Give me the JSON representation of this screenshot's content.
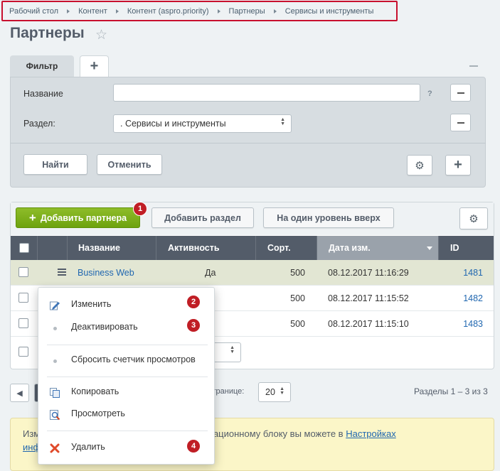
{
  "breadcrumb": [
    "Рабочий стол",
    "Контент",
    "Контент (aspro.priority)",
    "Партнеры",
    "Сервисы и инструменты"
  ],
  "page": {
    "title": "Партнеры"
  },
  "filter": {
    "tab_label": "Фильтр",
    "name_label": "Название",
    "name_value": "",
    "help": "?",
    "section_label": "Раздел:",
    "section_value": ". Сервисы и инструменты",
    "find_button": "Найти",
    "cancel_button": "Отменить"
  },
  "toolbar": {
    "add_partner": "Добавить партнера",
    "add_section": "Добавить раздел",
    "level_up": "На один уровень вверх"
  },
  "table": {
    "headers": [
      "Название",
      "Активность",
      "Сорт.",
      "Дата изм.",
      "ID"
    ],
    "rows": [
      {
        "name": "Business Web",
        "active": "Да",
        "sort": "500",
        "date": "08.12.2017 11:16:29",
        "id": "1481"
      },
      {
        "name": "",
        "active": "",
        "sort": "500",
        "date": "08.12.2017 11:15:52",
        "id": "1482"
      },
      {
        "name": "",
        "active": "",
        "sort": "500",
        "date": "08.12.2017 11:15:10",
        "id": "1483"
      }
    ]
  },
  "footer": {
    "per_page_label": "странице:",
    "per_page_value": "20",
    "range": "Разделы 1 – 3 из 3"
  },
  "info": {
    "line1_start": "Изм",
    "line1_end": "мационному блоку вы можете в ",
    "link": "Настройках",
    "line2_start": "инф"
  },
  "context_menu": {
    "items": [
      "Изменить",
      "Деактивировать",
      "Сбросить счетчик просмотров",
      "Копировать",
      "Просмотреть",
      "Удалить"
    ]
  },
  "badges": [
    "1",
    "2",
    "3",
    "4"
  ],
  "colors": {
    "accent_green": "#7bb01a",
    "header_dark": "#535c69",
    "badge_red": "#c01e25",
    "link_blue": "#2067b0",
    "highlight_red": "#c8102e"
  }
}
